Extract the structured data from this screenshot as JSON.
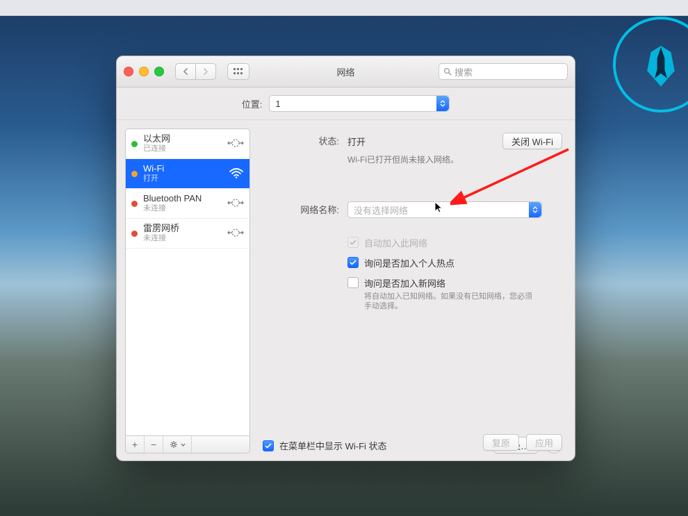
{
  "window": {
    "title": "网络",
    "search_placeholder": "搜索"
  },
  "location": {
    "label": "位置:",
    "value": "1"
  },
  "services": [
    {
      "name": "以太网",
      "status": "已连接",
      "dot": "green",
      "icon": "ethernet",
      "selected": false
    },
    {
      "name": "Wi-Fi",
      "status": "打开",
      "dot": "amber",
      "icon": "wifi",
      "selected": true
    },
    {
      "name": "Bluetooth PAN",
      "status": "未连接",
      "dot": "red",
      "icon": "ethernet",
      "selected": false
    },
    {
      "name": "雷雳网桥",
      "status": "未连接",
      "dot": "red",
      "icon": "ethernet",
      "selected": false
    }
  ],
  "sidebar_footer": {
    "add": "+",
    "remove": "−",
    "gear": "gear"
  },
  "detail": {
    "status_label": "状态:",
    "status_value": "打开",
    "status_sub": "Wi-Fi已打开但尚未接入网络。",
    "toggle_button": "关闭 Wi-Fi",
    "network_label": "网络名称:",
    "network_placeholder": "没有选择网络",
    "checks": {
      "auto_join": "自动加入此网络",
      "ask_hotspot": "询问是否加入个人热点",
      "ask_new": "询问是否加入新网络",
      "ask_new_desc": "将自动加入已知网络。如果没有已知网络，您必须手动选择。"
    },
    "show_in_menubar": "在菜单栏中显示 Wi-Fi 状态",
    "advanced": "高级…"
  },
  "buttons": {
    "revert": "复原",
    "apply": "应用",
    "help": "?"
  }
}
